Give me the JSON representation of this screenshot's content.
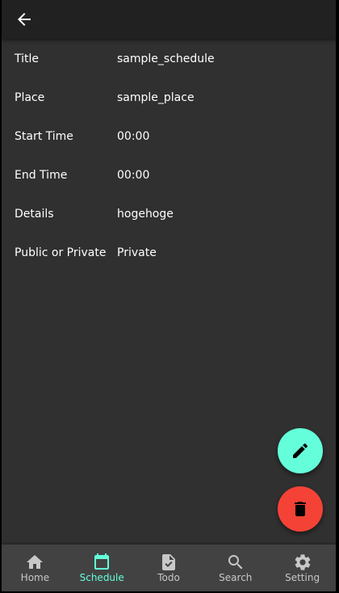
{
  "appbar": {
    "back_icon": "arrow-back-icon"
  },
  "details": [
    {
      "label": "Title",
      "value": "sample_schedule"
    },
    {
      "label": "Place",
      "value": "sample_place"
    },
    {
      "label": "Start Time",
      "value": "00:00"
    },
    {
      "label": "End Time",
      "value": "00:00"
    },
    {
      "label": "Details",
      "value": "hogehoge"
    },
    {
      "label": "Public or Private",
      "value": "Private"
    }
  ],
  "fabs": {
    "edit": {
      "icon": "pencil-icon",
      "color": "#64ffda"
    },
    "delete": {
      "icon": "trash-icon",
      "color": "#f44336"
    }
  },
  "bottom_nav": {
    "active_color": "#64ffda",
    "items": [
      {
        "label": "Home",
        "icon": "home-icon"
      },
      {
        "label": "Schedule",
        "icon": "calendar-icon"
      },
      {
        "label": "Todo",
        "icon": "task-icon"
      },
      {
        "label": "Search",
        "icon": "search-icon"
      },
      {
        "label": "Setting",
        "icon": "gear-icon"
      }
    ]
  }
}
